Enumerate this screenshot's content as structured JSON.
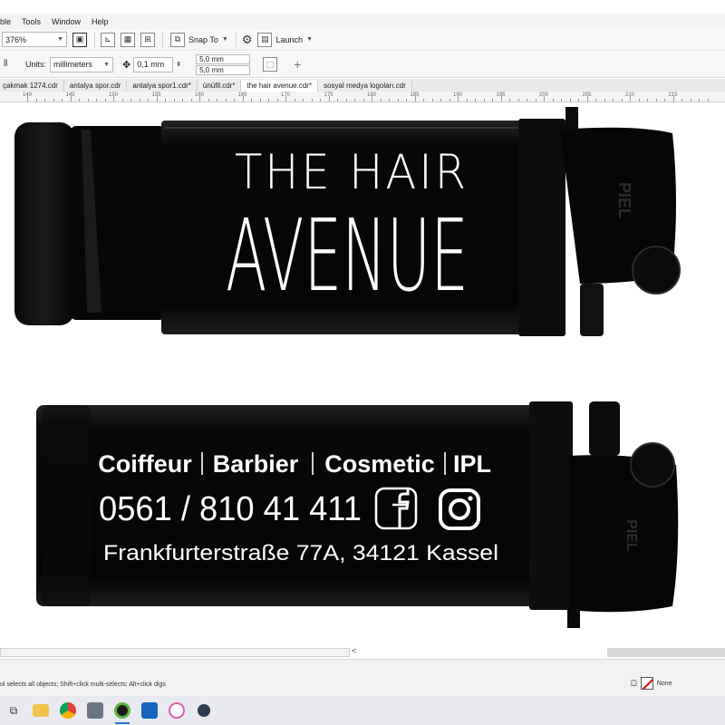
{
  "menu": {
    "items": [
      "ble",
      "Tools",
      "Window",
      "Help"
    ]
  },
  "toolbar": {
    "zoom_value": "376%",
    "snap_label": "Snap To",
    "launch_label": "Launch"
  },
  "propbar": {
    "units_label": "Units:",
    "units_value": "millimeters",
    "nudge_value": "0,1 mm",
    "dup_x": "5,0 mm",
    "dup_y": "5,0 mm"
  },
  "tabs": [
    "çakmak 1274.cdr",
    "antalya spor.cdr",
    "antalya spor1.cdr*",
    "ünüfil.cdr*",
    "the hair avenue.cdr*",
    "sosyal medya logoları.cdr"
  ],
  "ruler_labels": [
    "140",
    "145",
    "150",
    "155",
    "160",
    "165",
    "170",
    "175",
    "180",
    "185",
    "190",
    "195",
    "200",
    "205",
    "210",
    "215"
  ],
  "design": {
    "top_line1": "THE HAIR",
    "top_line2": "AVENUE",
    "services": [
      "Coiffeur",
      "Barbier",
      "Cosmetic",
      "IPL"
    ],
    "phone": "0561 / 810 41 411",
    "address": "Frankfurterstraße 77A, 34121 Kassel",
    "cap_marking": "PIEL",
    "colors": {
      "lighter_body": "#0b0b0b",
      "print": "#ffffff",
      "canvas": "#ffffff"
    }
  },
  "status": {
    "hint": "ol selects all objects; Shift+click multi-selects; Alt+click digs",
    "fill_label": "None"
  },
  "taskbar": {
    "apps": [
      "task-view",
      "file-explorer",
      "chrome",
      "calculator",
      "coreldraw",
      "outlook",
      "itunes",
      "other-app"
    ]
  }
}
